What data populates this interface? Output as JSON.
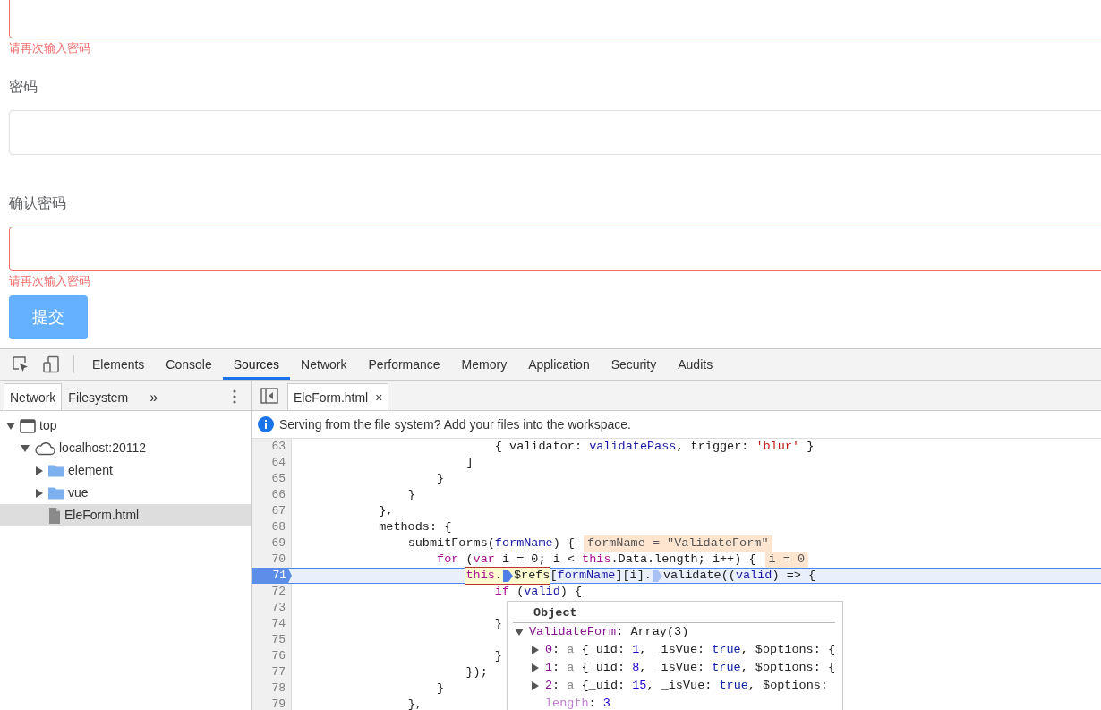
{
  "form": {
    "items": [
      {
        "invalid": true,
        "error": "请再次输入密码"
      },
      {
        "label": "密码",
        "invalid": false
      },
      {
        "label": "确认密码",
        "invalid": true,
        "error": "请再次输入密码"
      }
    ],
    "submit": "提交"
  },
  "devtools": {
    "tabs": [
      {
        "label": "Elements",
        "selected": false
      },
      {
        "label": "Console",
        "selected": false
      },
      {
        "label": "Sources",
        "selected": true
      },
      {
        "label": "Network",
        "selected": false
      },
      {
        "label": "Performance",
        "selected": false
      },
      {
        "label": "Memory",
        "selected": false
      },
      {
        "label": "Application",
        "selected": false
      },
      {
        "label": "Security",
        "selected": false
      },
      {
        "label": "Audits",
        "selected": false
      }
    ],
    "navigator": {
      "tabs": [
        {
          "label": "Network",
          "selected": true
        },
        {
          "label": "Filesystem",
          "selected": false
        }
      ],
      "more": "»",
      "tree": [
        {
          "label": "top",
          "kind": "frame",
          "expanded": true,
          "selected": false,
          "children": [
            {
              "label": "localhost:20112",
              "kind": "domain",
              "expanded": true,
              "selected": false,
              "children": [
                {
                  "label": "element",
                  "kind": "folder",
                  "expanded": false,
                  "selected": false
                },
                {
                  "label": "vue",
                  "kind": "folder",
                  "expanded": false,
                  "selected": false
                },
                {
                  "label": "EleForm.html",
                  "kind": "file",
                  "selected": true
                }
              ]
            }
          ]
        }
      ]
    },
    "editor": {
      "tab": {
        "label": "EleForm.html",
        "close": "×"
      },
      "infobar": "Serving from the file system? Add your files into the workspace.",
      "lines": [
        {
          "number": "63",
          "current": false,
          "segments": [
            {
              "kind": "plain",
              "text": "                            { validator: "
            },
            {
              "kind": "prop",
              "text": "validatePass"
            },
            {
              "kind": "plain",
              "text": ", trigger: "
            },
            {
              "kind": "str",
              "text": "'blur'"
            },
            {
              "kind": "plain",
              "text": " }"
            }
          ]
        },
        {
          "number": "64",
          "current": false,
          "segments": [
            {
              "kind": "plain",
              "text": "                        ]"
            }
          ]
        },
        {
          "number": "65",
          "current": false,
          "segments": [
            {
              "kind": "plain",
              "text": "                    }"
            }
          ]
        },
        {
          "number": "66",
          "current": false,
          "segments": [
            {
              "kind": "plain",
              "text": "                }"
            }
          ]
        },
        {
          "number": "67",
          "current": false,
          "segments": [
            {
              "kind": "plain",
              "text": "            },"
            }
          ]
        },
        {
          "number": "68",
          "current": false,
          "segments": [
            {
              "kind": "plain",
              "text": "            methods: {"
            }
          ]
        },
        {
          "number": "69",
          "current": false,
          "segments": [
            {
              "kind": "plain",
              "text": "                submitForms("
            },
            {
              "kind": "prop",
              "text": "formName"
            },
            {
              "kind": "plain",
              "text": ") {"
            }
          ],
          "inline_value": "formName = \"ValidateForm\""
        },
        {
          "number": "70",
          "current": false,
          "segments": [
            {
              "kind": "kw",
              "text": "                    for"
            },
            {
              "kind": "plain",
              "text": " ("
            },
            {
              "kind": "kw",
              "text": "var"
            },
            {
              "kind": "plain",
              "text": " i = 0; i < "
            },
            {
              "kind": "kw",
              "text": "this"
            },
            {
              "kind": "plain",
              "text": ".Data.length; i++) {"
            }
          ],
          "inline_value": "i = 0"
        },
        {
          "number": "71",
          "current": true,
          "segments": [
            {
              "kind": "kw",
              "text": "                        this",
              "boxed": true
            },
            {
              "kind": "plain",
              "text": ".",
              "boxed": true
            },
            {
              "kind": "marker",
              "active": true,
              "boxed": true
            },
            {
              "kind": "plain",
              "text": "$refs",
              "boxed": true
            },
            {
              "kind": "plain",
              "text": "["
            },
            {
              "kind": "prop",
              "text": "formName"
            },
            {
              "kind": "plain",
              "text": "][i]."
            },
            {
              "kind": "marker",
              "active": false
            },
            {
              "kind": "plain",
              "text": "validate(("
            },
            {
              "kind": "prop",
              "text": "valid"
            },
            {
              "kind": "plain",
              "text": ") => {"
            }
          ]
        },
        {
          "number": "72",
          "current": false,
          "segments": [
            {
              "kind": "kw",
              "text": "                            if"
            },
            {
              "kind": "plain",
              "text": " ("
            },
            {
              "kind": "prop",
              "text": "valid"
            },
            {
              "kind": "plain",
              "text": ") {"
            }
          ]
        },
        {
          "number": "73",
          "current": false
        },
        {
          "number": "74",
          "current": false,
          "segments": [
            {
              "kind": "plain",
              "text": "                            }"
            }
          ]
        },
        {
          "number": "75",
          "current": false
        },
        {
          "number": "76",
          "current": false,
          "segments": [
            {
              "kind": "plain",
              "text": "                            }"
            }
          ]
        },
        {
          "number": "77",
          "current": false,
          "segments": [
            {
              "kind": "plain",
              "text": "                        });"
            }
          ]
        },
        {
          "number": "78",
          "current": false,
          "segments": [
            {
              "kind": "plain",
              "text": "                    }"
            }
          ]
        },
        {
          "number": "79",
          "current": false,
          "segments": [
            {
              "kind": "plain",
              "text": "                },"
            }
          ]
        }
      ],
      "popover": {
        "title": "Object",
        "rows": [
          {
            "expanded": true,
            "segments": [
              {
                "kind": "key",
                "text": "ValidateForm"
              },
              {
                "kind": "plain",
                "text": ": Array(3)"
              }
            ],
            "children": [
              {
                "expanded": false,
                "segments": [
                  {
                    "kind": "key",
                    "text": "0"
                  },
                  {
                    "kind": "plain",
                    "text": ": "
                  },
                  {
                    "kind": "dim",
                    "text": "a"
                  },
                  {
                    "kind": "plain",
                    "text": " {_uid: "
                  },
                  {
                    "kind": "num",
                    "text": "1"
                  },
                  {
                    "kind": "plain",
                    "text": ", _isVue: "
                  },
                  {
                    "kind": "bool",
                    "text": "true"
                  },
                  {
                    "kind": "plain",
                    "text": ", $options: {"
                  }
                ]
              },
              {
                "expanded": false,
                "segments": [
                  {
                    "kind": "key",
                    "text": "1"
                  },
                  {
                    "kind": "plain",
                    "text": ": "
                  },
                  {
                    "kind": "dim",
                    "text": "a"
                  },
                  {
                    "kind": "plain",
                    "text": " {_uid: "
                  },
                  {
                    "kind": "num",
                    "text": "8"
                  },
                  {
                    "kind": "plain",
                    "text": ", _isVue: "
                  },
                  {
                    "kind": "bool",
                    "text": "true"
                  },
                  {
                    "kind": "plain",
                    "text": ", $options: {"
                  }
                ]
              },
              {
                "expanded": false,
                "segments": [
                  {
                    "kind": "key",
                    "text": "2"
                  },
                  {
                    "kind": "plain",
                    "text": ": "
                  },
                  {
                    "kind": "dim",
                    "text": "a"
                  },
                  {
                    "kind": "plain",
                    "text": " {_uid: "
                  },
                  {
                    "kind": "num",
                    "text": "15"
                  },
                  {
                    "kind": "plain",
                    "text": ", _isVue: "
                  },
                  {
                    "kind": "bool",
                    "text": "true"
                  },
                  {
                    "kind": "plain",
                    "text": ", $options:"
                  }
                ]
              },
              {
                "segments": [
                  {
                    "kind": "meta",
                    "text": "length"
                  },
                  {
                    "kind": "plain",
                    "text": ": "
                  },
                  {
                    "kind": "num",
                    "text": "3"
                  }
                ]
              }
            ]
          }
        ]
      }
    }
  }
}
